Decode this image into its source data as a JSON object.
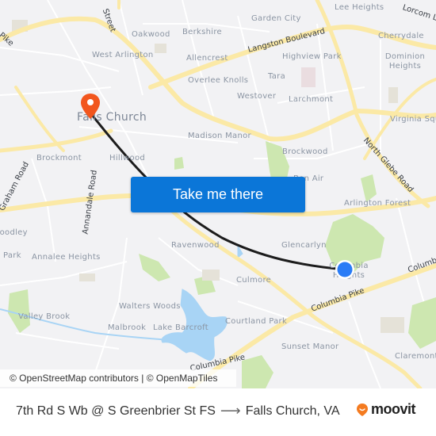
{
  "map": {
    "places": [
      {
        "name": "Garden City",
        "size": "small"
      },
      {
        "name": "Lee Heights",
        "size": "small"
      },
      {
        "name": "Oakwood",
        "size": "small"
      },
      {
        "name": "Berkshire",
        "size": "small"
      },
      {
        "name": "Cherrydale",
        "size": "small"
      },
      {
        "name": "West Arlington",
        "size": "small"
      },
      {
        "name": "Allencrest",
        "size": "small"
      },
      {
        "name": "Highview Park",
        "size": "small"
      },
      {
        "name": "Dominion Heights",
        "size": "small"
      },
      {
        "name": "Tara",
        "size": "small"
      },
      {
        "name": "Overlee Knolls",
        "size": "small"
      },
      {
        "name": "Westover",
        "size": "small"
      },
      {
        "name": "Larchmont",
        "size": "small"
      },
      {
        "name": "Falls Church",
        "size": "big"
      },
      {
        "name": "Virginia Square",
        "size": "small"
      },
      {
        "name": "Madison Manor",
        "size": "small"
      },
      {
        "name": "Brockwood",
        "size": "small"
      },
      {
        "name": "Brockmont",
        "size": "small"
      },
      {
        "name": "Hillwood",
        "size": "small"
      },
      {
        "name": "Bon Air",
        "size": "small"
      },
      {
        "name": "Arlington Forest",
        "size": "small"
      },
      {
        "name": "Woodley",
        "size": "small"
      },
      {
        "name": "Glencarlyn",
        "size": "small"
      },
      {
        "name": "Park",
        "size": "small"
      },
      {
        "name": "Annalee Heights",
        "size": "small"
      },
      {
        "name": "Ravenwood",
        "size": "small"
      },
      {
        "name": "Columbia Heights",
        "size": "small"
      },
      {
        "name": "Culmore",
        "size": "small"
      },
      {
        "name": "Walters Woods",
        "size": "small"
      },
      {
        "name": "Valley Brook",
        "size": "small"
      },
      {
        "name": "Malbrook",
        "size": "small"
      },
      {
        "name": "Lake Barcroft",
        "size": "small"
      },
      {
        "name": "Courtland Park",
        "size": "small"
      },
      {
        "name": "Sunset Manor",
        "size": "small"
      },
      {
        "name": "Claremont",
        "size": "small"
      }
    ],
    "roads": [
      {
        "name": "Street"
      },
      {
        "name": "Pike"
      },
      {
        "name": "Langston Boulevard"
      },
      {
        "name": "Lorcom Lane"
      },
      {
        "name": "North Glebe Road"
      },
      {
        "name": "Annandale Road"
      },
      {
        "name": "Graham Road"
      },
      {
        "name": "Columbia Pike"
      },
      {
        "name": "Columbia Pike"
      },
      {
        "name": "Columbia Pike"
      }
    ],
    "origin_marker": "current-location-dot",
    "destination_marker": "destination-pin",
    "colors": {
      "route": "#1c1c1c",
      "origin": "#2a7cf6",
      "destination": "#f2561d",
      "primary_button": "#0b76d8",
      "road": "#fbe9a6",
      "park": "#cde7b0",
      "water": "#a8d4f5"
    }
  },
  "cta": {
    "label": "Take me there"
  },
  "attribution": {
    "text": "© OpenStreetMap contributors | © OpenMapTiles"
  },
  "footer": {
    "origin": "7th Rd S Wb @ S Greenbrier St FS",
    "arrow": "⟶",
    "destination": "Falls Church, VA",
    "brand": "moovit"
  }
}
